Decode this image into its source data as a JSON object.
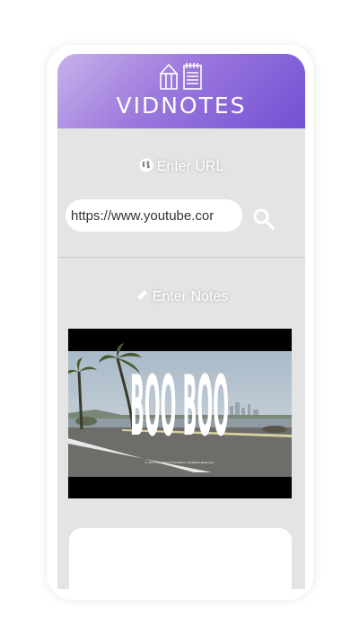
{
  "header": {
    "title": "VIDNOTES",
    "gradient": [
      "#c9b0ea",
      "#9a78dd",
      "#7450d4"
    ],
    "logo_icons": [
      "pencil-cup-icon",
      "notepad-icon"
    ]
  },
  "url_section": {
    "label": "Enter URL",
    "icon": "globe-icon",
    "input_value": "https://www.youtube.cor",
    "search_icon": "search-icon"
  },
  "notes_section": {
    "label": "Enter Notes",
    "icon": "pencil-icon"
  },
  "video": {
    "title_text": "BOO BOO",
    "credit_text": "© 2017 Company Productions. All Rights Reserved."
  },
  "colors": {
    "screen_bg": "#e4e4e4",
    "accent": "#7450d4"
  }
}
